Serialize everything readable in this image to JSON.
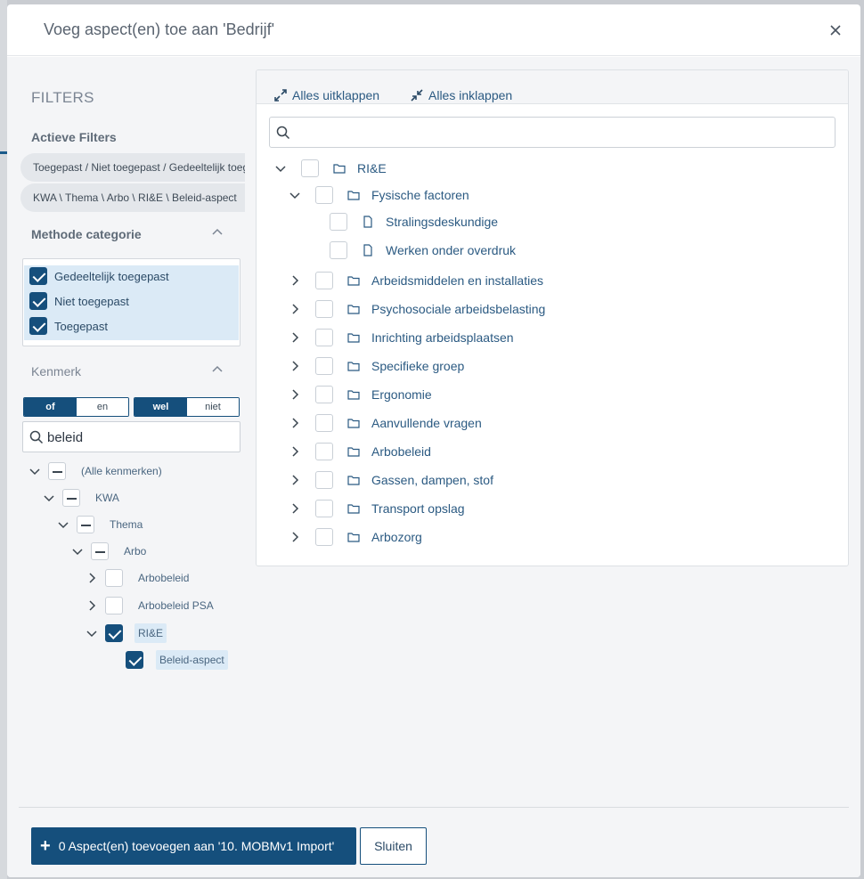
{
  "modal": {
    "title": "Voeg aspect(en) toe aan 'Bedrijf'"
  },
  "sidebar": {
    "filters_title": "FILTERS",
    "active_filters_title": "Actieve Filters",
    "active_filters": [
      "Toegepast / Niet toegepast / Gedeeltelijk toegepast",
      "KWA \\ Thema \\ Arbo \\ RI&E \\ Beleid-aspect"
    ],
    "methode_title": "Methode categorie",
    "methode_options": [
      {
        "label": "Gedeeltelijk toegepast",
        "checked": true
      },
      {
        "label": "Niet toegepast",
        "checked": true
      },
      {
        "label": "Toegepast",
        "checked": true
      }
    ],
    "kenmerk_title": "Kenmerk",
    "toggle_logic": {
      "of": "of",
      "en": "en",
      "active": "of"
    },
    "toggle_include": {
      "wel": "wel",
      "niet": "niet",
      "active": "wel"
    },
    "search_value": "beleid",
    "tree": [
      {
        "label": "(Alle kenmerken)",
        "state": "partial",
        "expanded": true
      },
      {
        "label": "KWA",
        "state": "partial",
        "expanded": true
      },
      {
        "label": "Thema",
        "state": "partial",
        "expanded": true
      },
      {
        "label": "Arbo",
        "state": "partial",
        "expanded": true
      },
      {
        "label": "Arbobeleid",
        "state": "unchecked",
        "expanded": false
      },
      {
        "label": "Arbobeleid PSA",
        "state": "unchecked",
        "expanded": false
      },
      {
        "label": "RI&E",
        "state": "checked",
        "expanded": true
      },
      {
        "label": "Beleid-aspect",
        "state": "checked",
        "expanded": null
      }
    ]
  },
  "main": {
    "expand_all_label": "Alles uitklappen",
    "collapse_all_label": "Alles inklappen",
    "search_placeholder": "",
    "tree": [
      {
        "label": "RI&E",
        "type": "folder",
        "expanded": true
      },
      {
        "label": "Fysische factoren",
        "type": "folder",
        "expanded": true
      },
      {
        "label": "Stralingsdeskundige",
        "type": "file"
      },
      {
        "label": "Werken onder overdruk",
        "type": "file"
      },
      {
        "label": "Arbeidsmiddelen en installaties",
        "type": "folder",
        "expanded": false
      },
      {
        "label": "Psychosociale arbeidsbelasting",
        "type": "folder",
        "expanded": false
      },
      {
        "label": "Inrichting arbeidsplaatsen",
        "type": "folder",
        "expanded": false
      },
      {
        "label": "Specifieke groep",
        "type": "folder",
        "expanded": false
      },
      {
        "label": "Ergonomie",
        "type": "folder",
        "expanded": false
      },
      {
        "label": "Aanvullende vragen",
        "type": "folder",
        "expanded": false
      },
      {
        "label": "Arbobeleid",
        "type": "folder",
        "expanded": false
      },
      {
        "label": "Gassen, dampen, stof",
        "type": "folder",
        "expanded": false
      },
      {
        "label": "Transport opslag",
        "type": "folder",
        "expanded": false
      },
      {
        "label": "Arbozorg",
        "type": "folder",
        "expanded": false
      }
    ]
  },
  "footer": {
    "add_label": "0 Aspect(en) toevoegen aan '10. MOBMv1 Import'",
    "close_label": "Sluiten"
  },
  "colors": {
    "primary": "#154f7c",
    "selected_bg": "#dbeaf6",
    "link": "#2b5a82"
  },
  "icons": [
    "close-icon",
    "search-icon",
    "chevron-down-icon",
    "chevron-right-icon",
    "chevron-up-icon",
    "folder-icon",
    "file-icon",
    "expand-icon",
    "collapse-icon",
    "plus-icon"
  ]
}
